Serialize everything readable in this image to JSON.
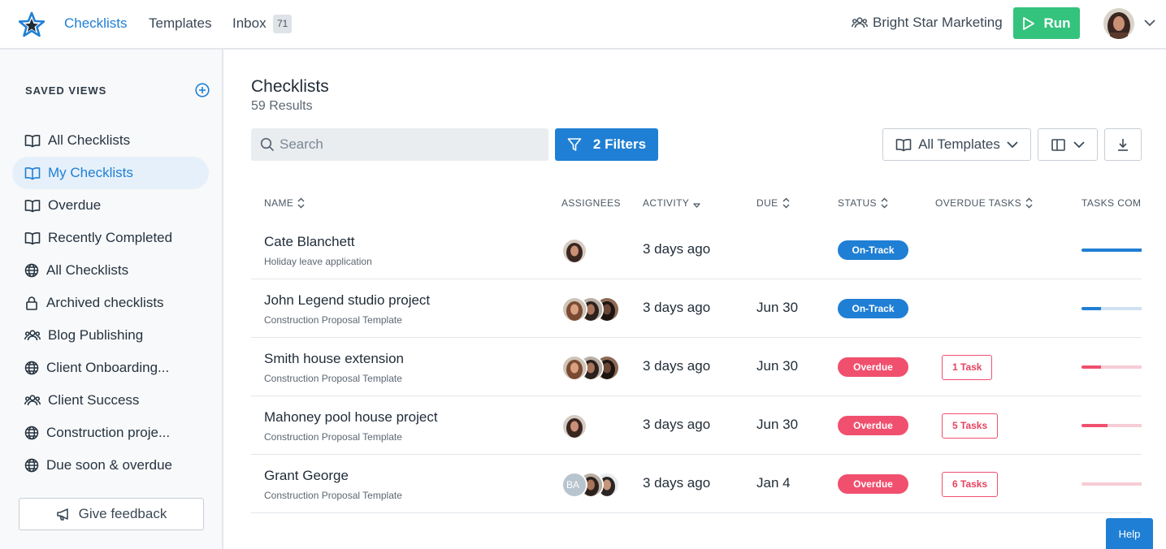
{
  "nav": {
    "links": [
      "Checklists",
      "Templates",
      "Inbox"
    ],
    "inbox_count": "71",
    "org_name": "Bright Star Marketing",
    "run_label": "Run"
  },
  "sidebar": {
    "title": "SAVED VIEWS",
    "items": [
      {
        "label": "All Checklists",
        "icon": "book-icon"
      },
      {
        "label": "My Checklists",
        "icon": "book-icon",
        "active": true
      },
      {
        "label": "Overdue",
        "icon": "book-icon"
      },
      {
        "label": "Recently Completed",
        "icon": "book-icon"
      },
      {
        "label": "All Checklists",
        "icon": "globe-icon"
      },
      {
        "label": "Archived checklists",
        "icon": "lock-icon"
      },
      {
        "label": "Blog Publishing",
        "icon": "users-icon"
      },
      {
        "label": "Client Onboarding...",
        "icon": "globe-icon"
      },
      {
        "label": "Client Success",
        "icon": "users-icon"
      },
      {
        "label": "Construction proje...",
        "icon": "globe-icon"
      },
      {
        "label": "Due soon & overdue",
        "icon": "globe-icon"
      }
    ],
    "feedback_label": "Give feedback"
  },
  "main": {
    "title": "Checklists",
    "result_count": "59 Results",
    "search_placeholder": "Search",
    "filters_label": "2 Filters",
    "templates_label": "All Templates"
  },
  "table": {
    "headers": [
      "NAME",
      "ASSIGNEES",
      "ACTIVITY",
      "DUE",
      "STATUS",
      "OVERDUE TASKS",
      "TASKS COMPLETED"
    ],
    "rows": [
      {
        "name": "Cate Blanchett",
        "template": "Holiday leave application",
        "activity": "3 days ago",
        "due": "",
        "status": "On-Track",
        "overdue_tasks": "",
        "progress": 1.0
      },
      {
        "name": "John Legend studio project",
        "template": "Construction Proposal Template",
        "activity": "3 days ago",
        "due": "Jun 30",
        "status": "On-Track",
        "overdue_tasks": "",
        "progress": 0.3
      },
      {
        "name": "Smith house extension",
        "template": "Construction Proposal Template",
        "activity": "3 days ago",
        "due": "Jun 30",
        "status": "Overdue",
        "overdue_tasks": "1 Task",
        "progress": 0.3
      },
      {
        "name": "Mahoney pool house project",
        "template": "Construction Proposal Template",
        "activity": "3 days ago",
        "due": "Jun 30",
        "status": "Overdue",
        "overdue_tasks": "5 Tasks",
        "progress": 0.4
      },
      {
        "name": "Grant George",
        "template": "Construction Proposal Template",
        "activity": "3 days ago",
        "due": "Jan 4",
        "status": "Overdue",
        "overdue_tasks": "6 Tasks",
        "progress": 0.0
      }
    ],
    "assignee_initials": "BA"
  },
  "help_label": "Help",
  "colors": {
    "accent": "#1f7fd4",
    "run_green": "#34c37c",
    "overdue_red": "#f0506e",
    "on_track_track": "#cfe2f3",
    "overdue_track": "#f6cdd5"
  }
}
